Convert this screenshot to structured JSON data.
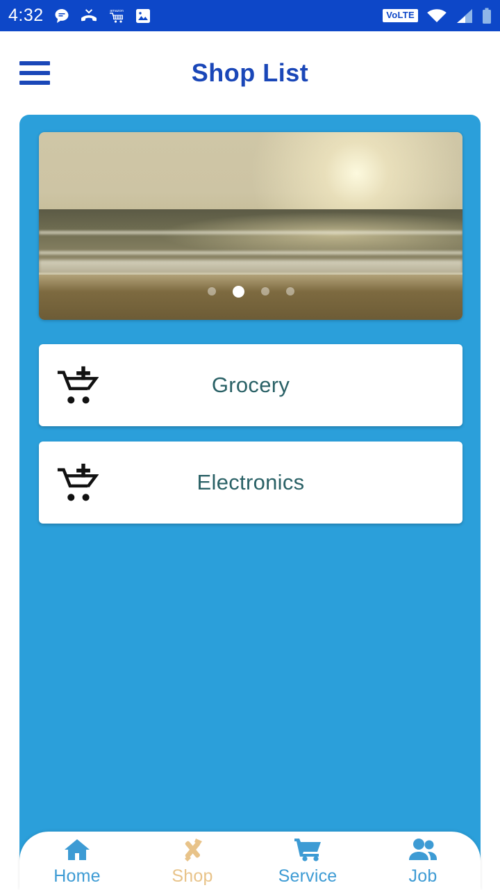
{
  "status_bar": {
    "time": "4:32",
    "left_icons": [
      {
        "name": "message-icon"
      },
      {
        "name": "missed-call-icon"
      },
      {
        "name": "amazon-cart-icon",
        "label": "amazon"
      },
      {
        "name": "image-icon"
      }
    ],
    "volte_label": "VoLTE",
    "right_icons": [
      {
        "name": "wifi-icon"
      },
      {
        "name": "cellular-signal-icon"
      },
      {
        "name": "battery-icon"
      }
    ],
    "background_color": "#0d47c8"
  },
  "header": {
    "title": "Shop List",
    "title_color": "#1a47b8",
    "menu_icon": "hamburger-menu-icon"
  },
  "panel": {
    "background_color": "#2b9fda"
  },
  "carousel": {
    "image_description": "beach sunset over ocean waves",
    "total_slides": 4,
    "active_slide": 2,
    "dots": [
      {
        "active": false
      },
      {
        "active": true
      },
      {
        "active": false
      },
      {
        "active": false
      }
    ]
  },
  "categories": {
    "label_color": "#2a6166",
    "items": [
      {
        "label": "Grocery",
        "icon": "add-to-cart-icon"
      },
      {
        "label": "Electronics",
        "icon": "add-to-cart-icon"
      }
    ]
  },
  "bottom_nav": {
    "active_color": "#e8c389",
    "inactive_color": "#3d9bd4",
    "items": [
      {
        "label": "Home",
        "icon": "home-icon",
        "active": false
      },
      {
        "label": "Shop",
        "icon": "tools-icon",
        "active": true
      },
      {
        "label": "Service",
        "icon": "shopping-cart-icon",
        "active": false
      },
      {
        "label": "Job",
        "icon": "people-icon",
        "active": false
      }
    ]
  }
}
